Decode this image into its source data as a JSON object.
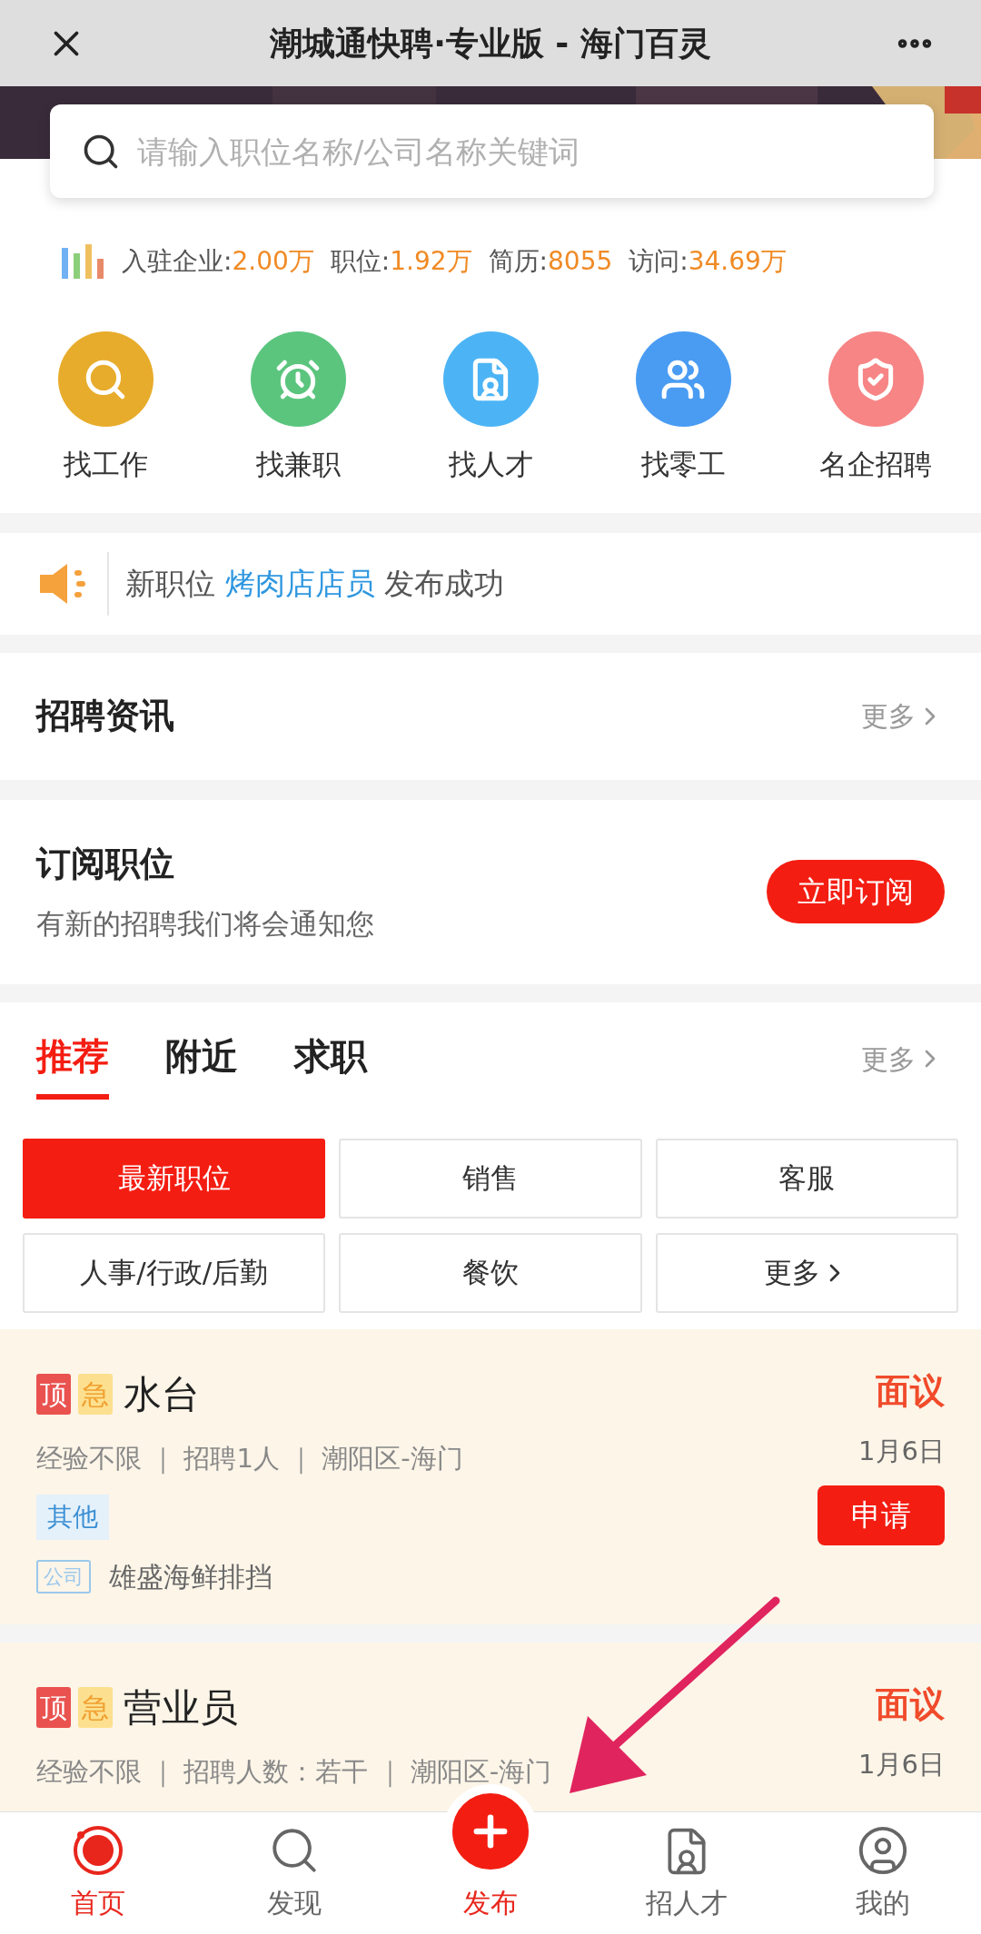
{
  "header": {
    "title": "潮城通快聘·专业版 - 海门百灵"
  },
  "search": {
    "placeholder": "请输入职位名称/公司名称关键词"
  },
  "stats": [
    {
      "label": "入驻企业:",
      "value": "2.00万"
    },
    {
      "label": "职位:",
      "value": "1.92万"
    },
    {
      "label": "简历:",
      "value": "8055"
    },
    {
      "label": "访问:",
      "value": "34.69万"
    }
  ],
  "shortcuts": [
    {
      "label": "找工作",
      "color": "#e8ac2c"
    },
    {
      "label": "找兼职",
      "color": "#5bc57e"
    },
    {
      "label": "找人才",
      "color": "#4cb4f5"
    },
    {
      "label": "找零工",
      "color": "#4a9cf3"
    },
    {
      "label": "名企招聘",
      "color": "#f78585"
    }
  ],
  "notice": {
    "prefix": "新职位",
    "job": "烤肉店店员",
    "suffix": "发布成功"
  },
  "news": {
    "title": "招聘资讯",
    "more": "更多"
  },
  "subscribe": {
    "title": "订阅职位",
    "subtitle": "有新的招聘我们将会通知您",
    "button": "立即订阅"
  },
  "tabs": [
    {
      "label": "推荐",
      "selected": true
    },
    {
      "label": "附近",
      "selected": false
    },
    {
      "label": "求职",
      "selected": false
    }
  ],
  "tabs_more": "更多",
  "categories": [
    {
      "label": "最新职位",
      "selected": true
    },
    {
      "label": "销售",
      "selected": false
    },
    {
      "label": "客服",
      "selected": false
    },
    {
      "label": "人事/行政/后勤",
      "selected": false
    },
    {
      "label": "餐饮",
      "selected": false
    },
    {
      "label": "更多",
      "selected": false,
      "kind": "more"
    }
  ],
  "jobs": [
    {
      "top": "顶",
      "urgent": "急",
      "title": "水台",
      "meta": "经验不限 ｜ 招聘1人 ｜ 潮阳区-海门",
      "salary": "面议",
      "date": "1月6日",
      "apply": "申请",
      "tag": "其他",
      "company_badge": "公司",
      "company": "雄盛海鲜排挡"
    },
    {
      "top": "顶",
      "urgent": "急",
      "title": "营业员",
      "meta": "经验不限 ｜ 招聘人数：若干 ｜ 潮阳区-海门",
      "salary": "面议",
      "date": "1月6日"
    }
  ],
  "nav": [
    {
      "label": "首页",
      "kind": "home",
      "selected": true
    },
    {
      "label": "发现",
      "kind": "discover",
      "selected": false
    },
    {
      "label": "发布",
      "kind": "publish",
      "selected": false
    },
    {
      "label": "招人才",
      "kind": "talent",
      "selected": false
    },
    {
      "label": "我的",
      "kind": "me",
      "selected": false
    }
  ]
}
